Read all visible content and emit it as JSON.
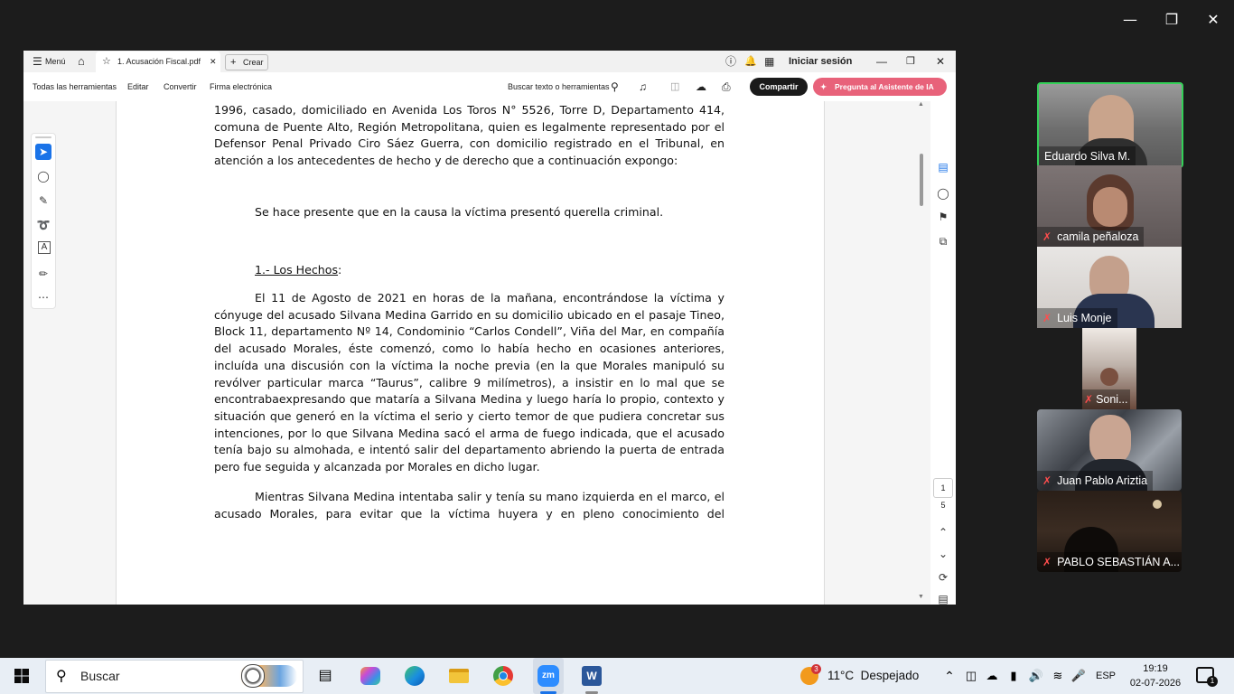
{
  "acrobat": {
    "menu_label": "Menú",
    "tab_title": "1. Acusación Fiscal.pdf",
    "new_tab_label": "Crear",
    "signin_label": "Iniciar sesión",
    "toolbar": {
      "items": [
        "Todas las herramientas",
        "Editar",
        "Convertir",
        "Firma electrónica"
      ],
      "search_label": "Buscar texto o herramientas",
      "share_label": "Compartir",
      "ai_label": "Pregunta al Asistente de IA"
    },
    "page_indicator": {
      "current": "1",
      "total": "5"
    }
  },
  "document": {
    "para1": [
      "1996, casado, domiciliado en Avenida Los Toros N° 5526, Torre D, Departamento 414,",
      "comuna de Puente Alto, Región Metropolitana, quien es legalmente representado por el",
      "Defensor Penal Privado Ciro Sáez Guerra, con domicilio registrado en el Tribunal, en",
      "atención a los antecedentes de hecho y de derecho que a continuación expongo:"
    ],
    "para2": "Se hace presente que en la causa la víctima presentó querella criminal.",
    "heading_num": "1.- Los Hechos",
    "heading_colon": ":",
    "para3": [
      "El 11 de Agosto de 2021 en horas de la mañana, encontrándose la víctima y",
      "cónyuge del acusado Silvana Medina Garrido en su domicilio ubicado en el pasaje Tineo,",
      "Block 11, departamento Nº 14, Condominio “Carlos Condell”, Viña del Mar, en compañía",
      "del acusado Morales, éste comenzó, como lo había hecho en ocasiones anteriores,",
      "incluída una discusión con la víctima la noche previa (en la que Morales manipuló su",
      "revólver particular marca “Taurus”, calibre 9 milímetros), a insistir en lo mal que se",
      "encontrabaexpresando que mataría a Silvana Medina y luego haría lo propio, contexto y",
      "situación que generó en la víctima el serio y cierto temor de que pudiera concretar sus",
      "intenciones, por lo que Silvana Medina sacó el arma de fuego indicada, que el acusado",
      "tenía bajo su almohada, e intentó salir del departamento abriendo la puerta de entrada",
      "pero fue seguida y alcanzada por Morales en dicho lugar."
    ],
    "para4": [
      "Mientras Silvana Medina intentaba salir y tenía su mano izquierda en el marco, el",
      "acusado Morales, para evitar que la víctima huyera y en pleno conocimiento del"
    ]
  },
  "participants": [
    "Eduardo Silva M.",
    "camila peñaloza",
    "Luis Monje",
    "Soni...",
    "Juan Pablo Ariztia",
    "PABLO SEBASTIÁN A..."
  ],
  "taskbar": {
    "search_placeholder": "Buscar",
    "weather_badge": "3",
    "weather_text": "11°C  Despejado",
    "language": "ESP",
    "time": "19:19",
    "date": "02-07-2026",
    "notification_count": "1"
  },
  "colors": {
    "active_speaker_border": "#34d058",
    "ai_button": "#e8627a",
    "share_button": "#1a1a1a",
    "muted_mic": "#ff4d4d"
  }
}
